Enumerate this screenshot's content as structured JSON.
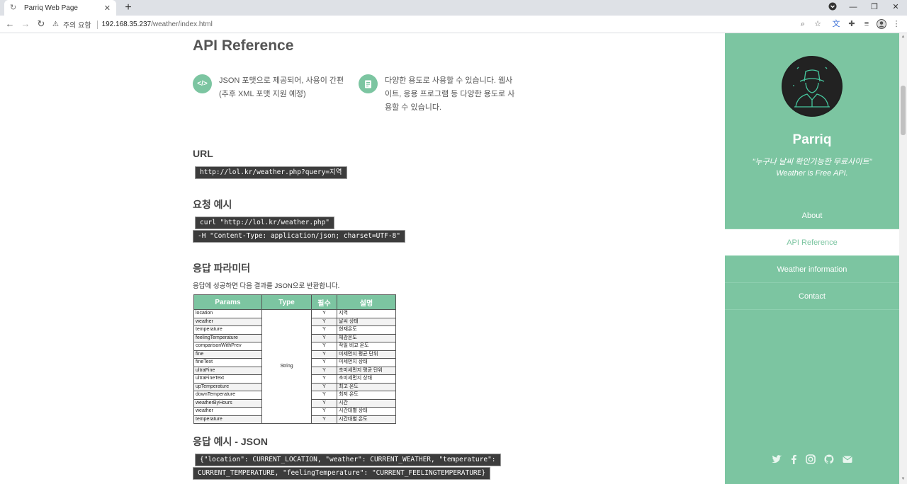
{
  "browser": {
    "tab_title": "Parriq Web Page",
    "tab_close": "✕",
    "new_tab": "+",
    "security_label": "주의 요함",
    "url_host": "192.168.35.237",
    "url_path": "/weather/index.html"
  },
  "page": {
    "title": "API Reference",
    "feature1_icon": "</>",
    "feature1_text_l1": "JSON 포맷으로 제공되어, 사용이 간편",
    "feature1_text_l2": "(추후 XML 포맷 지원 예정)",
    "feature2_text_l1": "다양한 용도로 사용할 수 있습니다. 웹사",
    "feature2_text_l2": "이트, 응용 프로그램 등 다양한 용도로 사",
    "feature2_text_l3": "용할 수 있습니다.",
    "url_heading": "URL",
    "url_code": "http://lol.kr/weather.php?query=지역",
    "req_heading": "요청 예시",
    "req_code_l1": "curl \"http://lol.kr/weather.php\"",
    "req_code_l2": "-H \"Content-Type: application/json; charset=UTF-8\"",
    "resp_param_heading": "응답 파라미터",
    "resp_param_desc": "응답에 성공하면 다음 결과를 JSON으로 반환합니다.",
    "resp_json_heading": "응답 예시 - JSON",
    "resp_code_l1": "{\"location\": CURRENT_LOCATION, \"weather\": CURRENT_WEATHER, \"temperature\":",
    "resp_code_l2": "CURRENT_TEMPERATURE, \"feelingTemperature\": \"CURRENT_FEELINGTEMPERATURE}"
  },
  "table": {
    "headers": [
      "Params",
      "Type",
      "필수",
      "설명"
    ],
    "type_value": "String",
    "rows": [
      {
        "param": "location",
        "req": "Y",
        "desc": "지역"
      },
      {
        "param": "weather",
        "req": "Y",
        "desc": "날씨 상태"
      },
      {
        "param": "temperature",
        "req": "Y",
        "desc": "현재온도"
      },
      {
        "param": "feelingTemperature",
        "req": "Y",
        "desc": "체감온도"
      },
      {
        "param": "comparisonWithPrev",
        "req": "Y",
        "desc": "작일 비교 온도"
      },
      {
        "param": "fine",
        "req": "Y",
        "desc": "미세먼지 평균 단위"
      },
      {
        "param": "fineText",
        "req": "Y",
        "desc": "미세먼지 상태"
      },
      {
        "param": "ultraFine",
        "req": "Y",
        "desc": "초미세먼지 평균 단위"
      },
      {
        "param": "ultraFineText",
        "req": "Y",
        "desc": "초미세먼지 상태"
      },
      {
        "param": "upTemperature",
        "req": "Y",
        "desc": "최고 온도"
      },
      {
        "param": "downTemperature",
        "req": "Y",
        "desc": "최저 온도"
      },
      {
        "param": "weatherByHours",
        "req": "Y",
        "desc": "시간"
      },
      {
        "param": "weather",
        "req": "Y",
        "desc": "시간대별 상태"
      },
      {
        "param": "temperature",
        "req": "Y",
        "desc": "시간대별 온도"
      }
    ]
  },
  "sidebar": {
    "brand": "Parriq",
    "tagline_l1": "\"누구나 날씨 확인가능한 무료사이트\"",
    "tagline_l2": "Weather is Free API.",
    "nav": [
      "About",
      "API Reference",
      "Weather information",
      "Contact"
    ],
    "active_nav": "API Reference",
    "social_icons": [
      "twitter-icon",
      "facebook-icon",
      "instagram-icon",
      "github-icon",
      "envelope-icon"
    ]
  },
  "colors": {
    "accent": "#7cc5a1",
    "code_bg": "#3c3c3c"
  }
}
